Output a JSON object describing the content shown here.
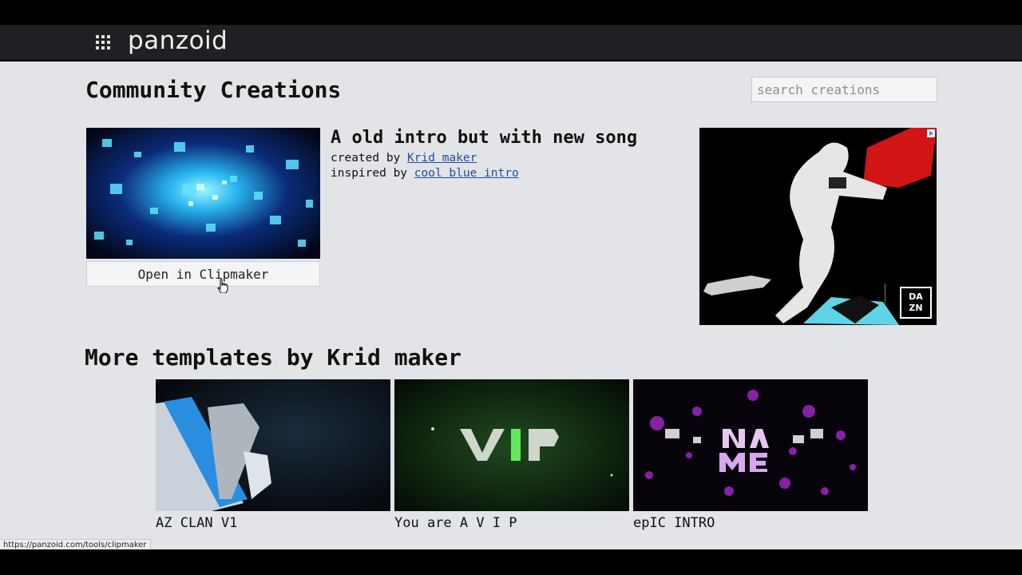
{
  "header": {
    "logo_text": "panzoid",
    "menu_icon": "grid-icon"
  },
  "page": {
    "title": "Community Creations",
    "search_placeholder": "search creations"
  },
  "creation": {
    "title": "A old intro but with new song",
    "created_by_label": "created by",
    "author": "Krid maker",
    "inspired_by_label": "inspired by",
    "inspired_from": "cool blue intro",
    "open_button_label": "Open in Clipmaker"
  },
  "ad": {
    "brand_text": "DA ZN"
  },
  "more_section": {
    "title": "More templates by Krid maker",
    "templates": [
      {
        "name": "AZ CLAN V1"
      },
      {
        "name": "You are A V I P"
      },
      {
        "name": "epIC INTRO"
      }
    ]
  },
  "status": {
    "url": "https://panzoid.com/tools/clipmaker"
  },
  "colors": {
    "topbar": "#1f2023",
    "page_bg": "#e2e4e7",
    "link": "#1d4fa3"
  }
}
